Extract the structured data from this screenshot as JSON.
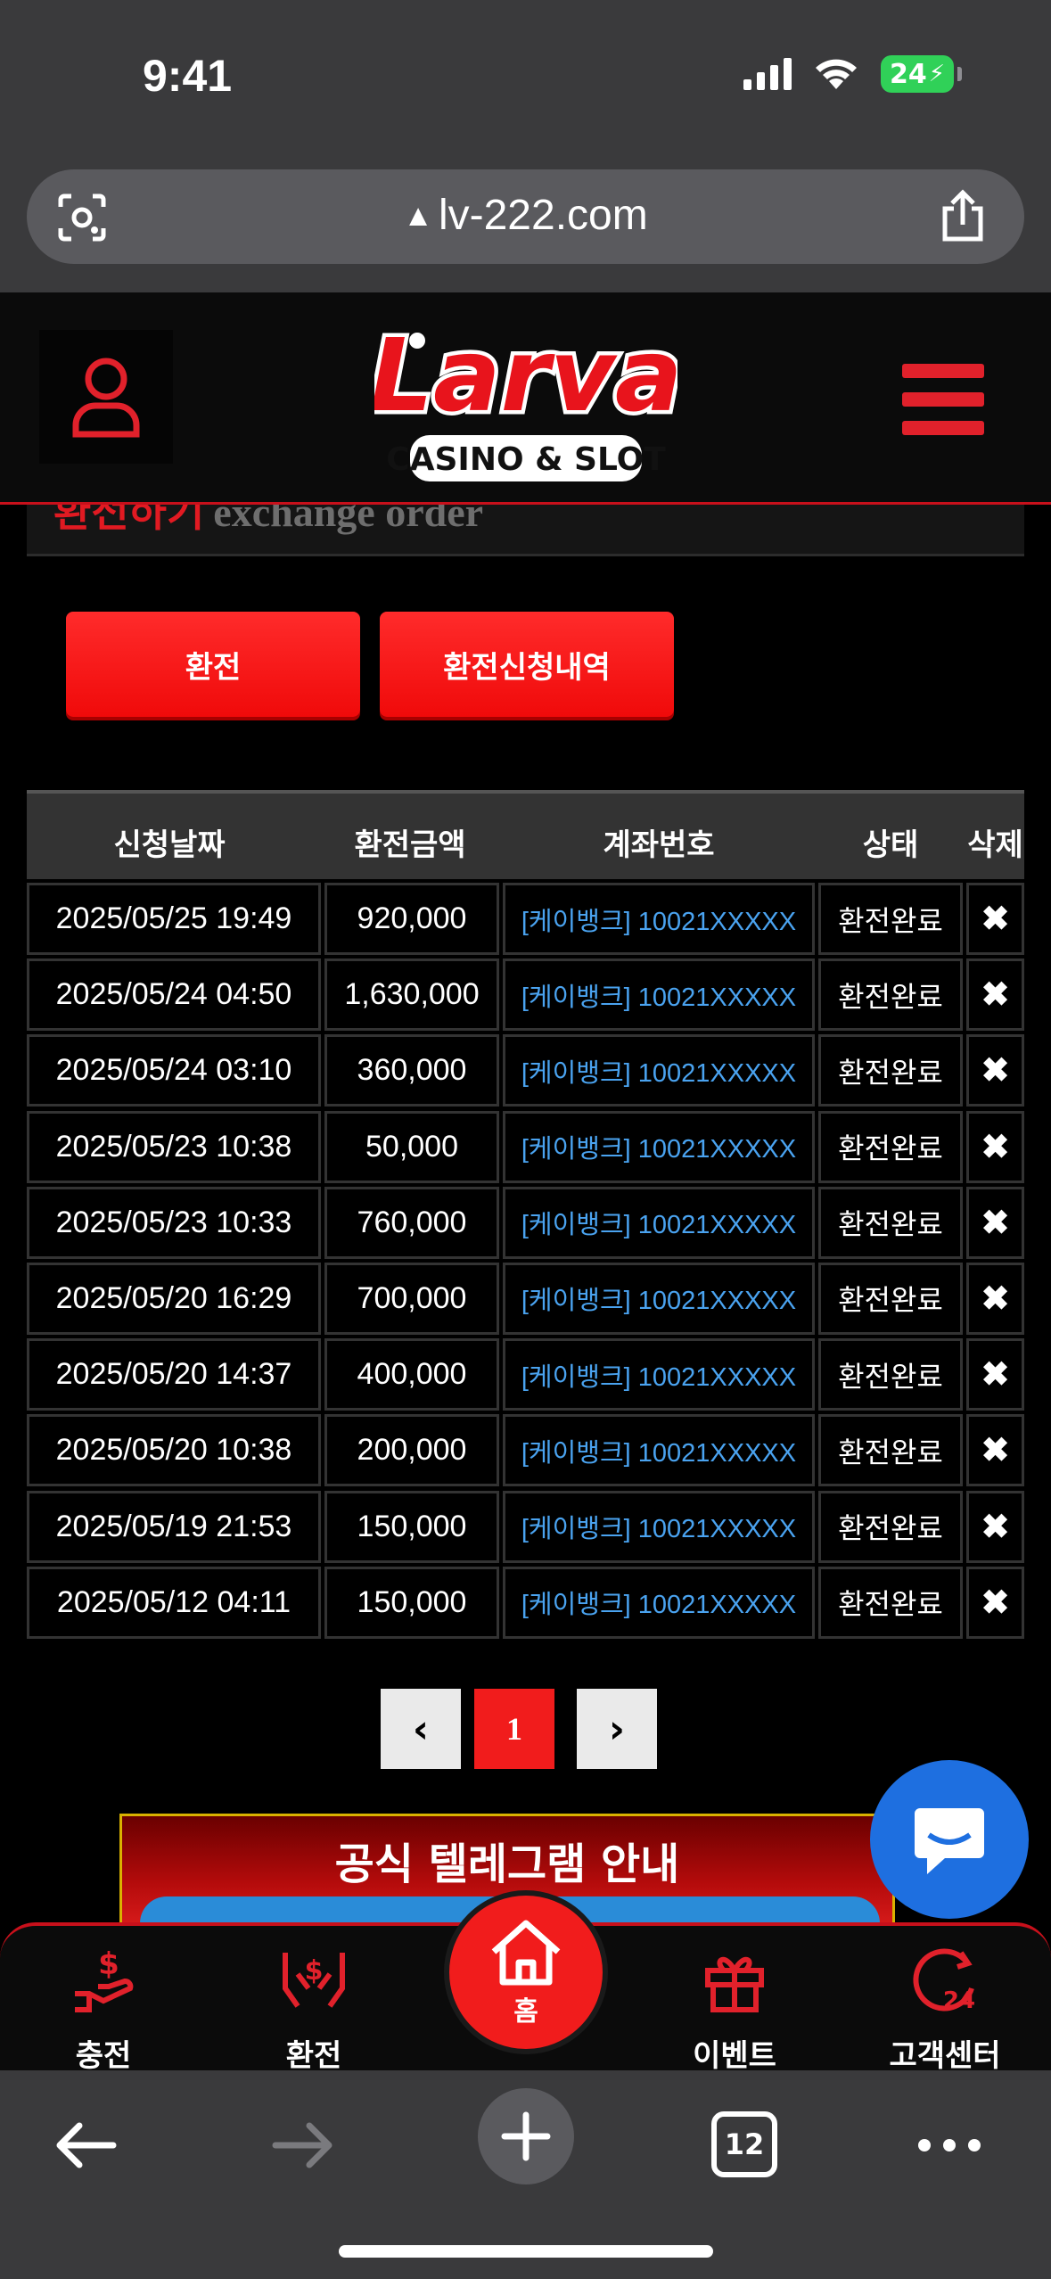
{
  "status_bar": {
    "time": "9:41",
    "battery": "24"
  },
  "browser": {
    "url": "lv-222.com",
    "tab_count": "12"
  },
  "page": {
    "title_kr": "환전하기",
    "title_en": "exchange order"
  },
  "actions": {
    "exchange_label": "환전",
    "history_label": "환전신청내역"
  },
  "table": {
    "headers": [
      "신청날짜",
      "환전금액",
      "계좌번호",
      "상태",
      "삭제"
    ],
    "rows": [
      {
        "date": "2025/05/25 19:49",
        "amount": "920,000",
        "account": "[케이뱅크] 10021XXXXX",
        "status": "환전완료"
      },
      {
        "date": "2025/05/24 04:50",
        "amount": "1,630,000",
        "account": "[케이뱅크] 10021XXXXX",
        "status": "환전완료"
      },
      {
        "date": "2025/05/24 03:10",
        "amount": "360,000",
        "account": "[케이뱅크] 10021XXXXX",
        "status": "환전완료"
      },
      {
        "date": "2025/05/23 10:38",
        "amount": "50,000",
        "account": "[케이뱅크] 10021XXXXX",
        "status": "환전완료"
      },
      {
        "date": "2025/05/23 10:33",
        "amount": "760,000",
        "account": "[케이뱅크] 10021XXXXX",
        "status": "환전완료"
      },
      {
        "date": "2025/05/20 16:29",
        "amount": "700,000",
        "account": "[케이뱅크] 10021XXXXX",
        "status": "환전완료"
      },
      {
        "date": "2025/05/20 14:37",
        "amount": "400,000",
        "account": "[케이뱅크] 10021XXXXX",
        "status": "환전완료"
      },
      {
        "date": "2025/05/20 10:38",
        "amount": "200,000",
        "account": "[케이뱅크] 10021XXXXX",
        "status": "환전완료"
      },
      {
        "date": "2025/05/19 21:53",
        "amount": "150,000",
        "account": "[케이뱅크] 10021XXXXX",
        "status": "환전완료"
      },
      {
        "date": "2025/05/12 04:11",
        "amount": "150,000",
        "account": "[케이뱅크] 10021XXXXX",
        "status": "환전완료"
      }
    ],
    "delete_glyph": "✖"
  },
  "pagination": {
    "prev": "‹",
    "current": "1",
    "next": "›"
  },
  "banner": {
    "text": "공식 텔레그램 안내"
  },
  "bottom_nav": {
    "charge": "충전",
    "exchange": "환전",
    "home": "홈",
    "event": "이벤트",
    "support": "고객센터"
  },
  "colors": {
    "brand_red": "#f11c1c",
    "account_link": "#4aa3f0",
    "chat_blue": "#1e6fe0"
  }
}
